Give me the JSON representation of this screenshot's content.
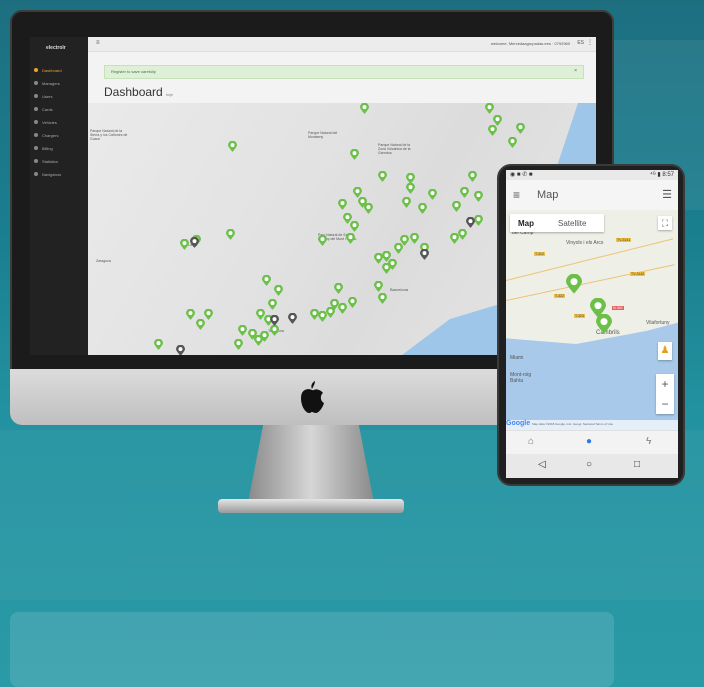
{
  "desktop": {
    "app_logo": "electrolr",
    "sidebar": {
      "items": [
        {
          "label": "Dashboard"
        },
        {
          "label": "Managers"
        },
        {
          "label": "Users"
        },
        {
          "label": "Cards"
        },
        {
          "label": "Vehicles"
        },
        {
          "label": "Chargers"
        },
        {
          "label": "Billing"
        },
        {
          "label": "Statistics"
        },
        {
          "label": "Navigators"
        }
      ]
    },
    "topbar": {
      "menu_icon": "hamburger-icon",
      "welcome_text": "welcome, Mercedaagrupadas.ees · 0792960",
      "language": "ES"
    },
    "alert": {
      "text": "Register to save carefully",
      "close": "×"
    },
    "page_title": "Dashboard",
    "page_subtitle": "hoje",
    "colors": {
      "pin_active": "#6cc04a",
      "pin_inactive": "#555555",
      "accent": "#f0a030",
      "sea": "#9ec6e8"
    },
    "map_labels": [
      "Parque Natural de la Sierra y los Cañones de Guara",
      "Parque Natural del Montseny",
      "Parque Natural de la Zona Volcánica de la Garrotxa",
      "Barcelona",
      "Zaragoza",
      "Lleida",
      "Tarragona",
      "Parc Natural de Sant Llorenç del Munt i l'Obac"
    ]
  },
  "mobile": {
    "status_bar": {
      "icons": "◉ ■ ✆ ■",
      "right": "⁴ᴳ ▮ 8:57"
    },
    "app_title": "Map",
    "map_type": {
      "map": "Map",
      "satellite": "Satellite"
    },
    "labels": [
      "del Camp",
      "Vinyols i els Arcs",
      "Mont-roig Bahía",
      "Miami",
      "Vilafortuny",
      "Cambrils"
    ],
    "road_tags": [
      "T-312",
      "TV-3141",
      "T-322",
      "TV-3142",
      "T-323",
      "N-340"
    ],
    "attribution": "Map data ©2018 Google, Inst. Geogr. Nacional  Terms of Use",
    "google": "Google",
    "zoom_in": "+",
    "zoom_out": "−",
    "tabs": [
      "home-icon",
      "map-pin-icon",
      "bolt-icon"
    ],
    "nav": [
      "◁",
      "○",
      "□"
    ]
  }
}
